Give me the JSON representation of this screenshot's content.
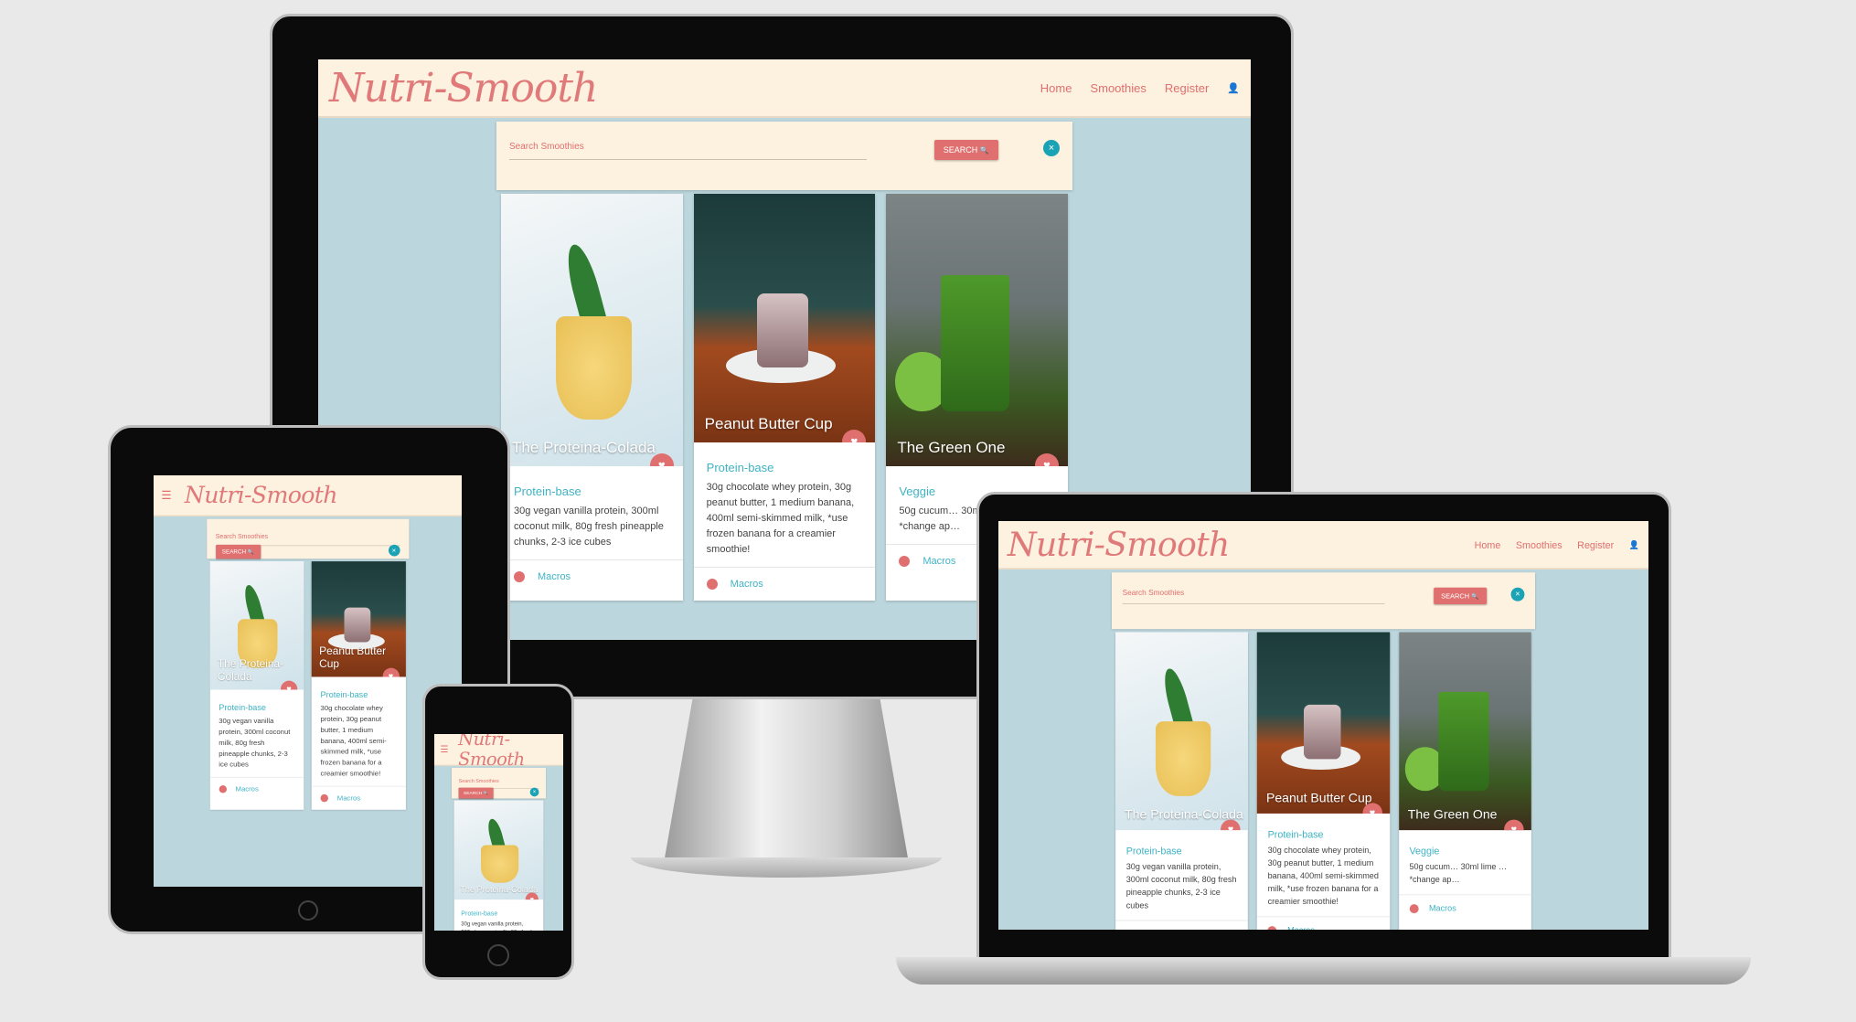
{
  "site": {
    "logo": "Nutri-Smooth",
    "nav": {
      "home": "Home",
      "smoothies": "Smoothies",
      "register": "Register"
    },
    "menu_icon": "☰",
    "user_icon": "👤",
    "search": {
      "placeholder": "Search Smoothies",
      "button": "SEARCH",
      "button_icon": "🔍",
      "close": "×"
    },
    "heart_icon": "♥",
    "macros_label": "Macros",
    "cards": [
      {
        "name": "The Proteina-Colada",
        "category": "Protein-base",
        "ingredients": "30g vegan vanilla protein, 300ml coconut milk, 80g fresh pineapple chunks, 2-3 ice cubes"
      },
      {
        "name": "Peanut Butter Cup",
        "category": "Protein-base",
        "ingredients": "30g chocolate whey protein, 30g peanut butter, 1 medium banana, 400ml semi-skimmed milk, *use frozen banana for a creamier smoothie!"
      },
      {
        "name": "The Green One",
        "category": "Veggie",
        "ingredients": "50g cucum… 30ml lime … *change ap…"
      }
    ]
  },
  "colors": {
    "header": "#fdf1df",
    "page": "#bcd6dd",
    "accent": "#e07070",
    "teal": "#1aa3b5"
  }
}
